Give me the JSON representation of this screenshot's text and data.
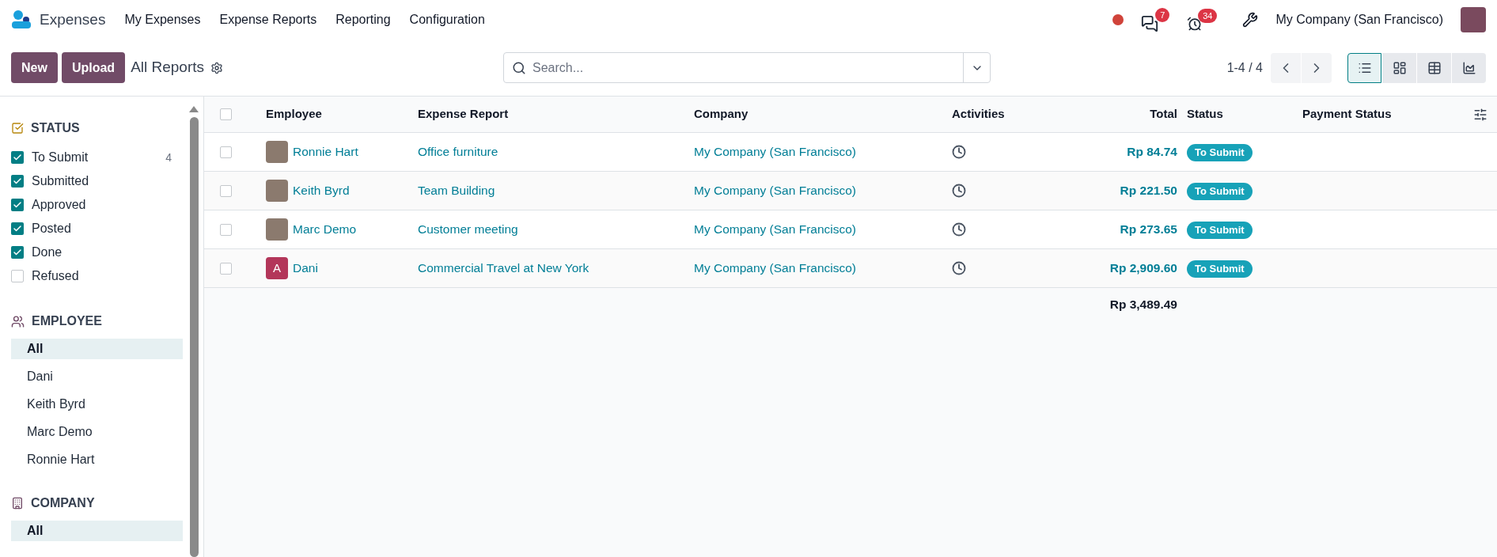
{
  "app": {
    "name": "Expenses"
  },
  "menu": [
    "My Expenses",
    "Expense Reports",
    "Reporting",
    "Configuration"
  ],
  "systray": {
    "messages_count": "7",
    "activities_count": "34",
    "company": "My Company (San Francisco)"
  },
  "control_panel": {
    "buttons": [
      "New",
      "Upload"
    ],
    "title": "All Reports",
    "search": {
      "placeholder": "Search..."
    },
    "pager": "1-4 / 4",
    "views": [
      {
        "kind": "list",
        "selected": true
      },
      {
        "kind": "kanban",
        "selected": false
      },
      {
        "kind": "pivot",
        "selected": false
      },
      {
        "kind": "graph",
        "selected": false
      }
    ]
  },
  "sidebar": {
    "sections": [
      {
        "kind": "checkboxes",
        "title": "STATUS",
        "items": [
          {
            "label": "To Submit",
            "count": "4",
            "checked": true
          },
          {
            "label": "Submitted",
            "checked": true
          },
          {
            "label": "Approved",
            "checked": true
          },
          {
            "label": "Posted",
            "checked": true
          },
          {
            "label": "Done",
            "checked": true
          },
          {
            "label": "Refused",
            "checked": false
          }
        ]
      },
      {
        "kind": "list",
        "title": "EMPLOYEE",
        "items": [
          {
            "label": "All",
            "selected": true
          },
          {
            "label": "Dani",
            "selected": false
          },
          {
            "label": "Keith Byrd",
            "selected": false
          },
          {
            "label": "Marc Demo",
            "selected": false
          },
          {
            "label": "Ronnie Hart",
            "selected": false
          }
        ]
      },
      {
        "kind": "list",
        "title": "COMPANY",
        "items": [
          {
            "label": "All",
            "selected": true
          }
        ]
      }
    ]
  },
  "table": {
    "select_all": {
      "checked": false
    },
    "columns": [
      "Employee",
      "Expense Report",
      "Company",
      "Activities",
      "Total",
      "Status",
      "Payment Status"
    ],
    "rows": [
      {
        "checked": false,
        "avatar": {
          "kind": "photo"
        },
        "employee": "Ronnie Hart",
        "expense_report": "Office furniture",
        "company": "My Company (San Francisco)",
        "total": "Rp 84.74",
        "status": "To Submit"
      },
      {
        "checked": false,
        "avatar": {
          "kind": "photo"
        },
        "employee": "Keith Byrd",
        "expense_report": "Team Building",
        "company": "My Company (San Francisco)",
        "total": "Rp 221.50",
        "status": "To Submit"
      },
      {
        "checked": false,
        "avatar": {
          "kind": "photo"
        },
        "employee": "Marc Demo",
        "expense_report": "Customer meeting",
        "company": "My Company (San Francisco)",
        "total": "Rp 273.65",
        "status": "To Submit"
      },
      {
        "checked": false,
        "avatar": {
          "kind": "letter",
          "letter": "A",
          "color": "#b3365a"
        },
        "employee": "Dani",
        "expense_report": "Commercial Travel at New York",
        "company": "My Company (San Francisco)",
        "total": "Rp 2,909.60",
        "status": "To Submit"
      }
    ],
    "sum_total": "Rp 3,489.49"
  }
}
